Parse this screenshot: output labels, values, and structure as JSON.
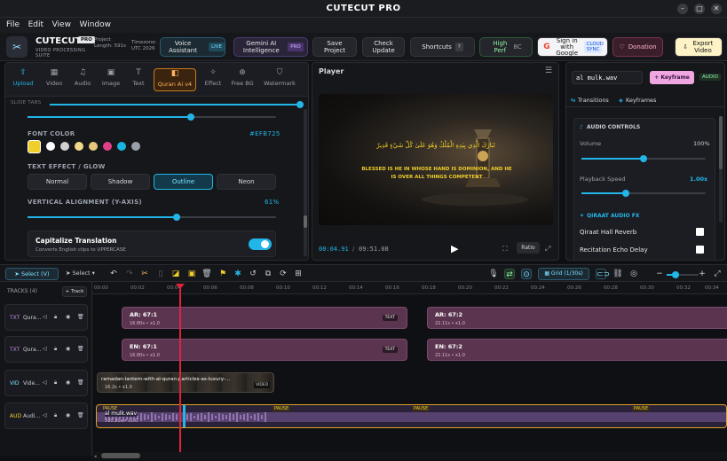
{
  "window": {
    "title": "CUTECUT PRO",
    "min": "–",
    "max": "□",
    "close": "✕"
  },
  "menu": [
    "File",
    "Edit",
    "View",
    "Window"
  ],
  "header": {
    "app_name": "CUTECUT",
    "app_badge": "PRO",
    "app_sub": "VIDEO PROCESSING SUITE",
    "project_length": "Project Length: 591s",
    "timezone": "Timezone: UTC 2026",
    "voice": "Voice Assistant",
    "voice_badge": "LIVE",
    "gemini": "Gemini AI Intelligence",
    "gemini_badge": "PRO",
    "save": "Save Project",
    "check": "Check Update",
    "shortcuts": "Shortcuts",
    "shortcuts_badge": "?",
    "perf": "High Perf",
    "perf_sub": "8C",
    "google": "Sign in with Google",
    "google_badge": "CLOUD SYNC",
    "donation": "Donation",
    "export": "Export Video"
  },
  "left": {
    "tabs": [
      "Upload",
      "Video",
      "Audio",
      "Image",
      "Text",
      "Quran Ai v4",
      "Effect",
      "Free BG",
      "Watermark"
    ],
    "tab_icons": [
      "⇪",
      "▦",
      "♫",
      "▣",
      "T",
      "◧",
      "✧",
      "⊕",
      "⛉"
    ],
    "slide_label": "SLIDE TABS",
    "font_color_label": "FONT COLOR",
    "font_color_value": "#EFB725",
    "swatches": [
      "#f0cf2a",
      "#ffffff",
      "#d0d0d0",
      "#f2d88a",
      "#e6c77a",
      "#e0408a",
      "#18b4e0",
      "#9aa0aa"
    ],
    "text_effect_label": "TEXT EFFECT / GLOW",
    "effects": [
      "Normal",
      "Shadow",
      "Outline",
      "Neon"
    ],
    "valign_label": "VERTICAL ALIGNMENT (Y-AXIS)",
    "valign_value": "61%",
    "capitalize_title": "Capitalize Translation",
    "capitalize_sub": "Converts English clips to UPPERCASE"
  },
  "player": {
    "title": "Player",
    "arabic": "تَبَارَكَ الَّذِي بِيَدِهِ الْمُلْكُ وَهُوَ عَلَىٰ كُلِّ شَيْءٍ قَدِيرٌ",
    "caption": "BLESSED IS HE IN WHOSE HAND IS DOMINION, AND HE IS OVER ALL THINGS COMPETENT",
    "current": "00:04.91",
    "total": "09:51.08",
    "ratio": "Ratio"
  },
  "right": {
    "audio_file": "al mulk.wav",
    "keyframe": "+ Keyframe",
    "audio_badge": "AUDIO",
    "tab_transitions": "Transitions",
    "tab_keyframes": "Keyframes",
    "audio_controls": "AUDIO CONTROLS",
    "volume_label": "Volume",
    "volume_value": "100%",
    "speed_label": "Playback Speed",
    "speed_value": "1.00x",
    "qiraat": "QIRAAT AUDIO FX",
    "reverb": "Qiraat Hall Reverb",
    "echo": "Recitation Echo Delay"
  },
  "timeline": {
    "select_mode": "Select (V)",
    "select_label": "Select",
    "grid": "Grid (1/30s)",
    "tracks_label": "TRACKS (4)",
    "add_track": "+ Track",
    "ticks": [
      "00:00",
      "00:02",
      "00:04",
      "00:06",
      "00:08",
      "00:10",
      "00:12",
      "00:14",
      "00:16",
      "00:18",
      "00:20",
      "00:22",
      "00:24",
      "00:26",
      "00:28",
      "00:30",
      "00:32",
      "00:34"
    ],
    "track_names": [
      {
        "type": "TXT",
        "name": "Qura..."
      },
      {
        "type": "TXT",
        "name": "Qura..."
      },
      {
        "type": "VID",
        "name": "Vide..."
      },
      {
        "type": "AUD",
        "name": "Audi..."
      }
    ],
    "clips_ar": [
      {
        "title": "AR: 67:1",
        "sub": "16.80s • x1.0",
        "tag": "TEXT"
      },
      {
        "title": "AR: 67:2",
        "sub": "22.11s • x1.0"
      }
    ],
    "clips_en": [
      {
        "title": "EN: 67:1",
        "sub": "16.80s • x1.0",
        "tag": "TEXT"
      },
      {
        "title": "EN: 67:2",
        "sub": "22.11s • x1.0"
      }
    ],
    "video_clip": {
      "title": "ramadan-lantern-with-al-quran-particles-as-luxury-...",
      "sub": "16.2s • x1.0",
      "tag": "VIDEO"
    },
    "audio_clip": {
      "title": "al mulk.wav",
      "sub": "570.20s • x1.0",
      "pause": "PAUSE"
    }
  }
}
